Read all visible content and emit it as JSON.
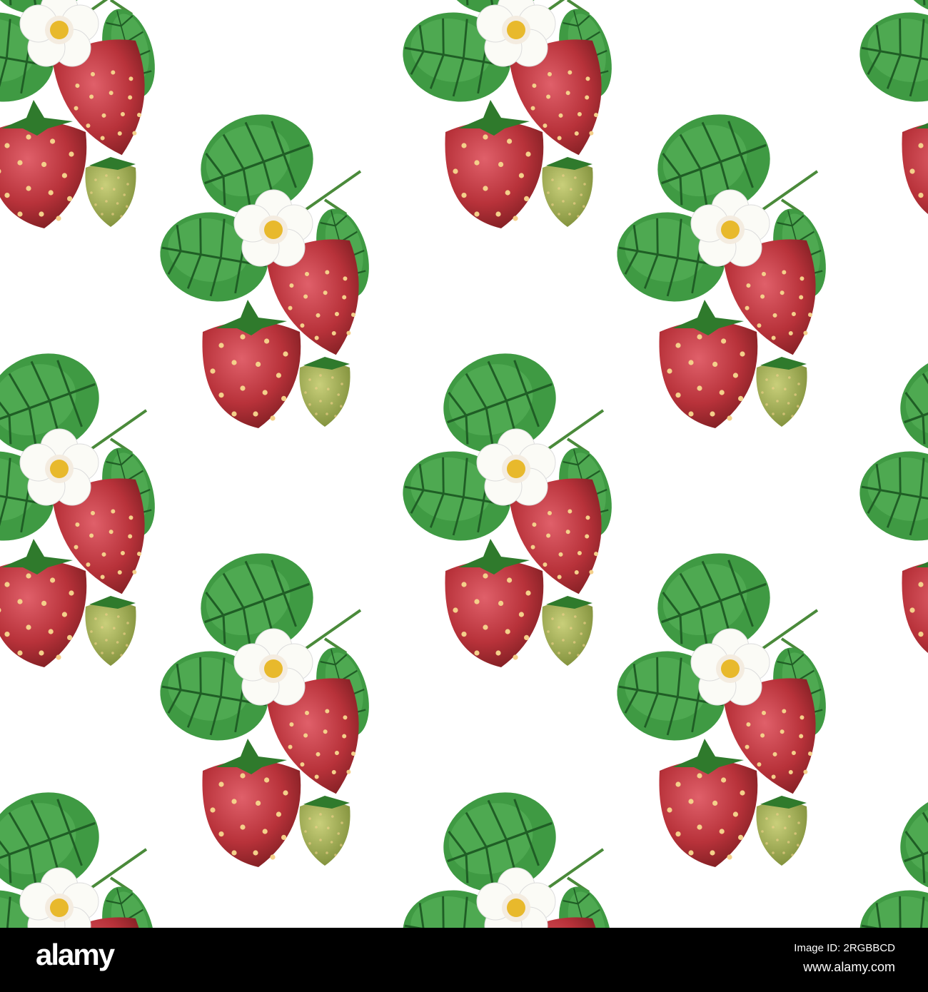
{
  "image": {
    "subject": "strawberry-pattern"
  },
  "footer": {
    "logo": "alamy",
    "image_id": "Image ID: 2RGBBCD",
    "website": "www.alamy.com"
  }
}
